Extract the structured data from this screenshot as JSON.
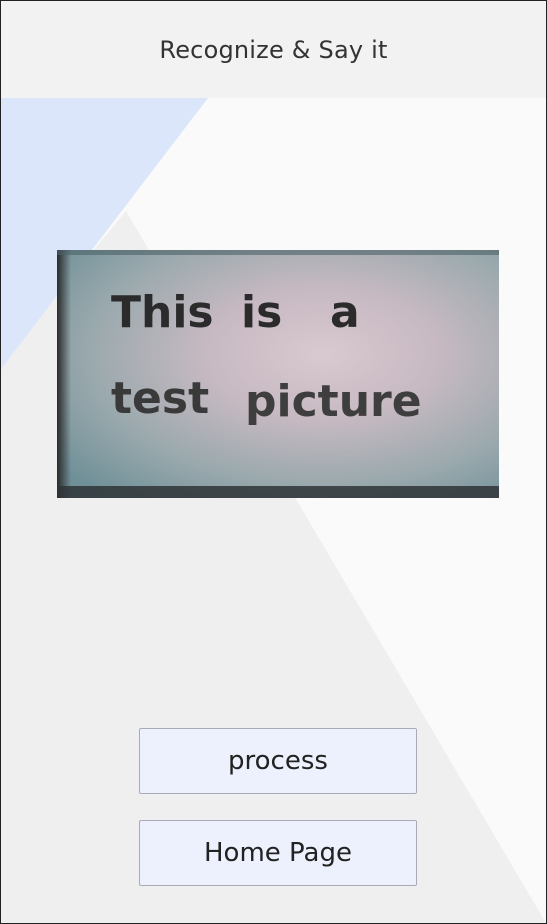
{
  "app": {
    "title": "Recognize & Say it"
  },
  "photo": {
    "line1": [
      "This",
      "is",
      "a"
    ],
    "line2": [
      "test",
      "picture"
    ]
  },
  "buttons": {
    "process_label": "process",
    "home_label": "Home Page"
  },
  "colors": {
    "app_bar": "#f2f2f2",
    "background": "#fafafa",
    "accent_triangle": "#dbe6fb",
    "grey_triangle": "#efefef",
    "button_fill": "#edf1fd",
    "button_border": "#a9abbb"
  }
}
